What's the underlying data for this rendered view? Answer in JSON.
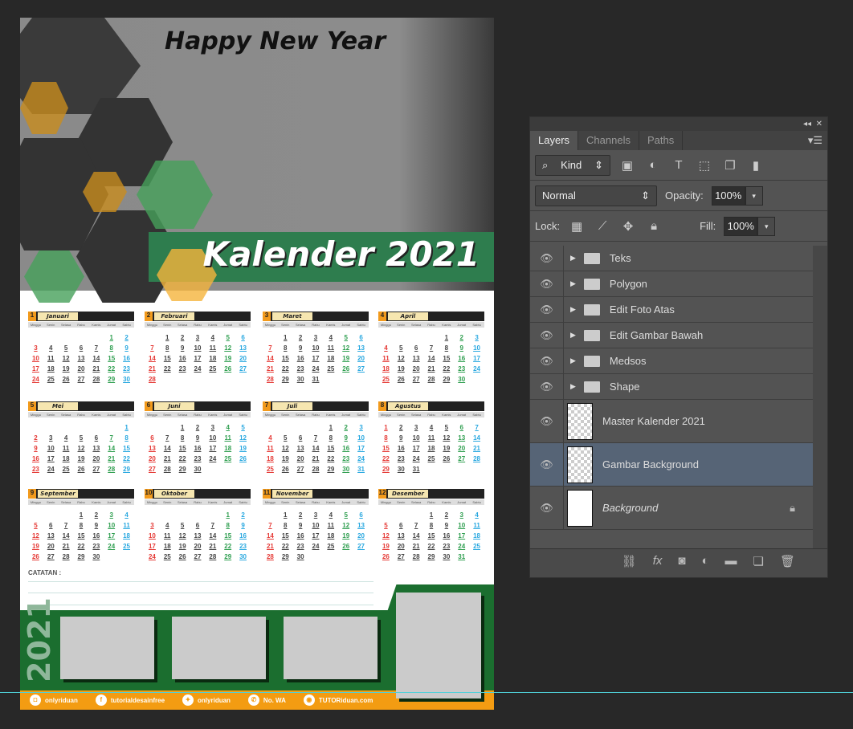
{
  "document": {
    "title": "Happy New Year",
    "headline": "Kalender 2021",
    "year": 2021,
    "notes_label": "CATATAN :",
    "side_year": "2021",
    "months": [
      "Januari",
      "Februari",
      "Maret",
      "April",
      "Mei",
      "Juni",
      "Juli",
      "Agustus",
      "September",
      "Oktober",
      "November",
      "Desember"
    ],
    "day_headers": [
      "Minggu",
      "Senin",
      "Selasa",
      "Rabu",
      "Kamis",
      "Jumat",
      "Sabtu"
    ],
    "social": [
      {
        "icon": "instagram-icon",
        "glyph": "◘",
        "label": "onlyriduan"
      },
      {
        "icon": "facebook-icon",
        "glyph": "f",
        "label": "tutorialdesainfree"
      },
      {
        "icon": "twitter-icon",
        "glyph": "✦",
        "label": "onlyriduan"
      },
      {
        "icon": "whatsapp-icon",
        "glyph": "✆",
        "label": "No. WA"
      },
      {
        "icon": "web-icon",
        "glyph": "◉",
        "label": "TUTORiduan.com"
      }
    ],
    "colors": {
      "green": "#1b6e2f",
      "orange": "#f39c12",
      "sunday": "#e53935",
      "friday": "#2e9e4f",
      "saturday": "#29a8e0"
    }
  },
  "panel": {
    "tabs": [
      "Layers",
      "Channels",
      "Paths"
    ],
    "filter": "Kind",
    "blend_mode": "Normal",
    "opacity_label": "Opacity:",
    "opacity": "100%",
    "lock_label": "Lock:",
    "fill_label": "Fill:",
    "fill": "100%",
    "layers": [
      {
        "name": "Teks",
        "type": "group"
      },
      {
        "name": "Polygon",
        "type": "group"
      },
      {
        "name": "Edit Foto Atas",
        "type": "group"
      },
      {
        "name": "Edit Gambar Bawah",
        "type": "group"
      },
      {
        "name": "Medsos",
        "type": "group"
      },
      {
        "name": "Shape",
        "type": "group"
      },
      {
        "name": "Master Kalender 2021",
        "type": "smart"
      },
      {
        "name": "Gambar Background",
        "type": "smart",
        "selected": true
      },
      {
        "name": "Background",
        "type": "background",
        "locked": true
      }
    ]
  }
}
